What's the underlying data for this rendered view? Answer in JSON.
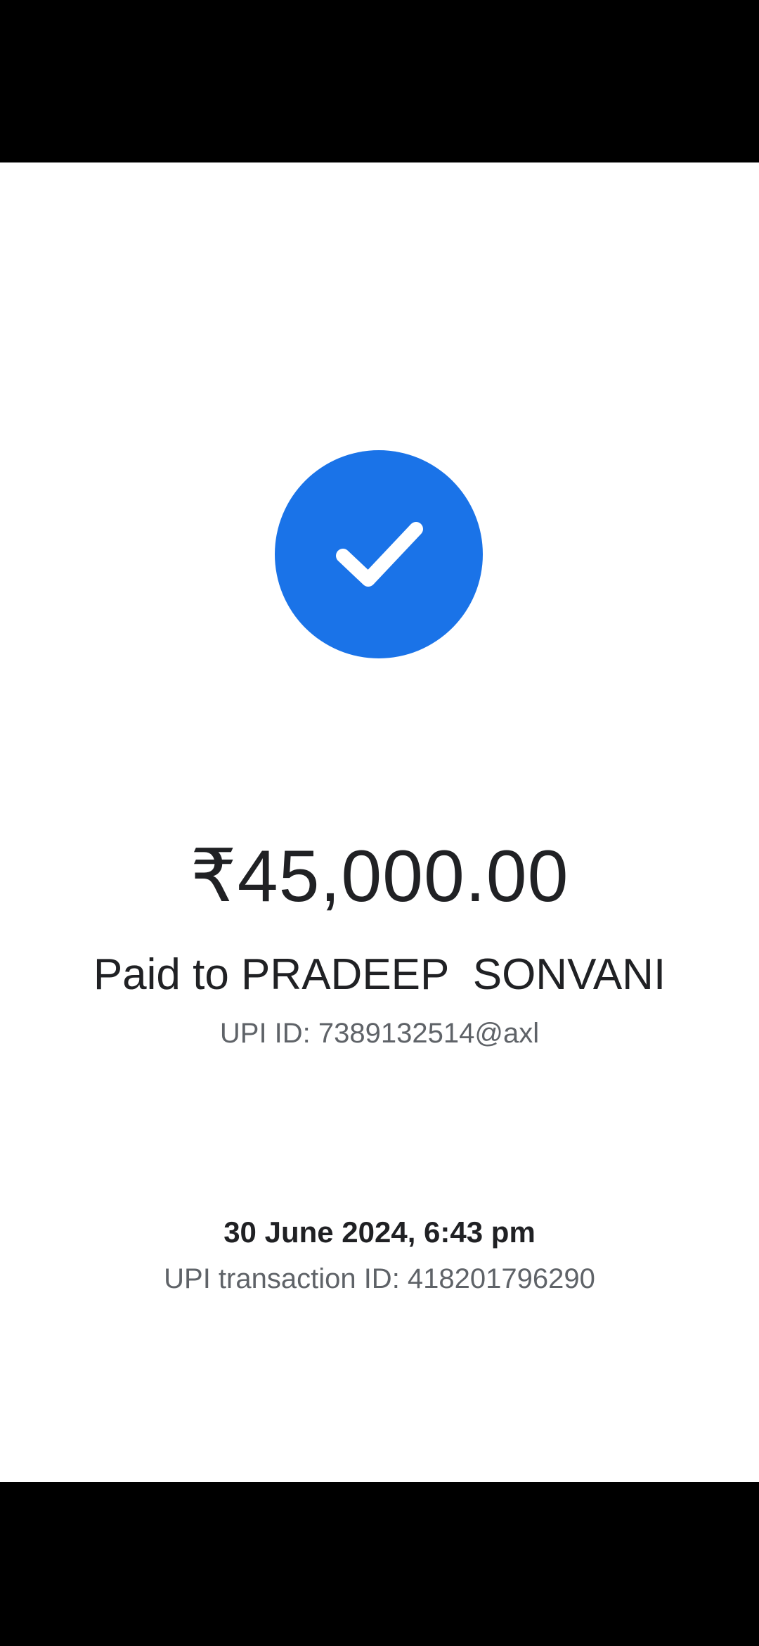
{
  "payment": {
    "status_icon": "check-icon",
    "accent_color": "#1a73e8",
    "amount": "₹45,000.00",
    "paid_to": "Paid to PRADEEP  SONVANI",
    "upi_id": "UPI ID: 7389132514@axl",
    "datetime": "30 June 2024, 6:43 pm",
    "transaction_id": "UPI transaction ID: 418201796290"
  }
}
